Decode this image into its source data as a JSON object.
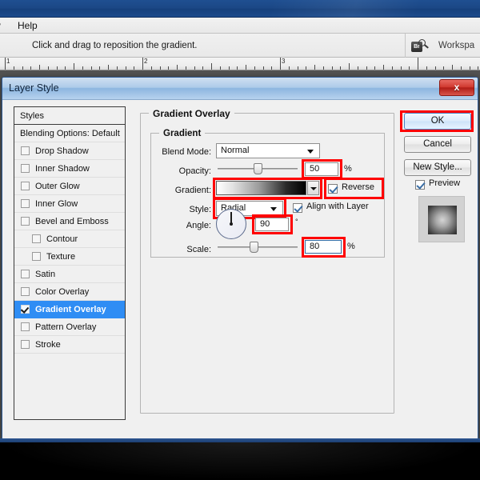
{
  "app": {
    "menus": [
      "w",
      "Help"
    ],
    "options_hint": "Click and drag to reposition the gradient.",
    "bridge_icon_label": "Br",
    "workspace_label": "Workspa",
    "ruler_numbers": [
      "1",
      "2",
      "3"
    ]
  },
  "dialog": {
    "title": "Layer Style",
    "close_label": "x",
    "styles": {
      "header": "Styles",
      "items": [
        {
          "label": "Blending Options: Default",
          "checkbox": false,
          "checked": false,
          "indent": false,
          "selected": false
        },
        {
          "label": "Drop Shadow",
          "checkbox": true,
          "checked": false,
          "indent": false,
          "selected": false
        },
        {
          "label": "Inner Shadow",
          "checkbox": true,
          "checked": false,
          "indent": false,
          "selected": false
        },
        {
          "label": "Outer Glow",
          "checkbox": true,
          "checked": false,
          "indent": false,
          "selected": false
        },
        {
          "label": "Inner Glow",
          "checkbox": true,
          "checked": false,
          "indent": false,
          "selected": false
        },
        {
          "label": "Bevel and Emboss",
          "checkbox": true,
          "checked": false,
          "indent": false,
          "selected": false
        },
        {
          "label": "Contour",
          "checkbox": true,
          "checked": false,
          "indent": true,
          "selected": false
        },
        {
          "label": "Texture",
          "checkbox": true,
          "checked": false,
          "indent": true,
          "selected": false
        },
        {
          "label": "Satin",
          "checkbox": true,
          "checked": false,
          "indent": false,
          "selected": false
        },
        {
          "label": "Color Overlay",
          "checkbox": true,
          "checked": false,
          "indent": false,
          "selected": false
        },
        {
          "label": "Gradient Overlay",
          "checkbox": true,
          "checked": true,
          "indent": false,
          "selected": true
        },
        {
          "label": "Pattern Overlay",
          "checkbox": true,
          "checked": false,
          "indent": false,
          "selected": false
        },
        {
          "label": "Stroke",
          "checkbox": true,
          "checked": false,
          "indent": false,
          "selected": false
        }
      ]
    },
    "panel": {
      "group_title": "Gradient Overlay",
      "subgroup_title": "Gradient",
      "blend_mode": {
        "label": "Blend Mode:",
        "value": "Normal"
      },
      "opacity": {
        "label": "Opacity:",
        "value": "50",
        "unit": "%",
        "percent": 50
      },
      "gradient": {
        "label": "Gradient:",
        "from_color": "#ffffff",
        "to_color": "#000000"
      },
      "reverse": {
        "label": "Reverse",
        "checked": true
      },
      "style": {
        "label": "Style:",
        "value": "Radial"
      },
      "align_with_layer": {
        "label": "Align with Layer",
        "checked": true
      },
      "angle": {
        "label": "Angle:",
        "value": "90",
        "unit": "°",
        "degrees": 90
      },
      "scale": {
        "label": "Scale:",
        "value": "80",
        "unit": "%",
        "percent": 45
      }
    },
    "actions": {
      "ok": "OK",
      "cancel": "Cancel",
      "new_style": "New Style...",
      "preview": {
        "label": "Preview",
        "checked": true
      }
    }
  },
  "colors": {
    "annotation_red": "#ff0000",
    "selection_blue": "#2f8df4",
    "titlebar_blue": "#1b4785"
  }
}
